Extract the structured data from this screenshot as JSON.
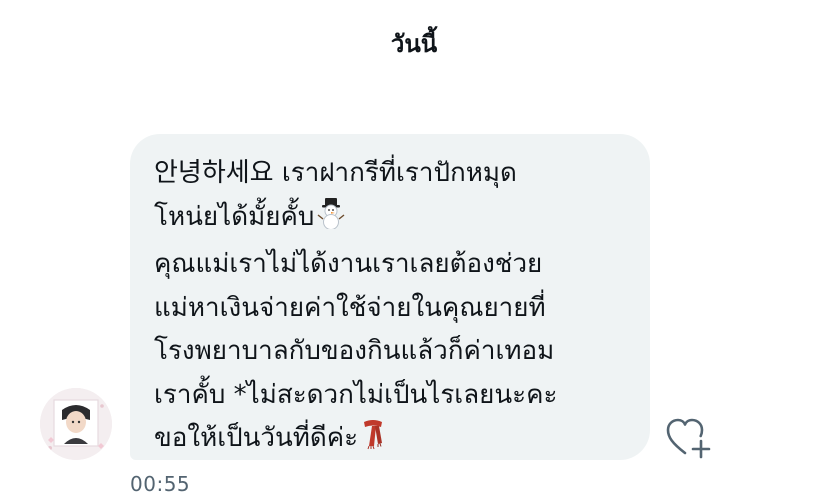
{
  "conversation": {
    "date_label": "วันนี้"
  },
  "message": {
    "lines": [
      "안녕하세요 เราฝากรีที่เราปักหมุด",
      "โหน่ยได้มั้ยคั้บ",
      "คุณแม่เราไม่ได้งานเราเลยต้องช่วย",
      "แม่หาเงินจ่ายค่าใช้จ่ายในคุณยายที่",
      "โรงพยาบาลกับของกินแล้วก็ค่าเทอม",
      "เราคั้บ   *ไม่สะดวกไม่เป็นไรเลยนะคะ",
      "ขอให้เป็นวันที่ดีค่ะ"
    ],
    "emoji_line_2": "snowman-emoji",
    "emoji_line_7": "scarf-emoji",
    "timestamp": "00:55",
    "bubble_color": "#eff3f4",
    "text_color": "#0f1419"
  },
  "sender": {
    "avatar_icon": "profile-photo"
  },
  "actions": {
    "react_icon": "heart-plus-icon"
  }
}
